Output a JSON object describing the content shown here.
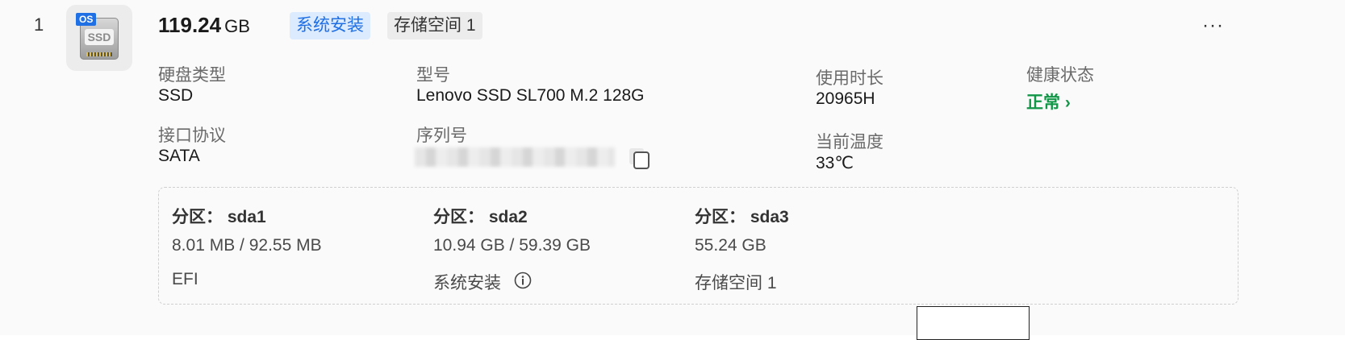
{
  "disk": {
    "index": "1",
    "icon_label": "SSD",
    "os_badge": "OS",
    "capacity_value": "119.24",
    "capacity_unit": "GB",
    "tags": [
      "系统安装",
      "存储空间 1"
    ],
    "more_label": "···"
  },
  "fields": {
    "disk_type_label": "硬盘类型",
    "disk_type_value": "SSD",
    "interface_label": "接口协议",
    "interface_value": "SATA",
    "model_label": "型号",
    "model_value": "Lenovo SSD SL700 M.2 128G",
    "serial_label": "序列号",
    "usage_label": "使用时长",
    "usage_value": "20965H",
    "temp_label": "当前温度",
    "temp_value": "33℃",
    "health_label": "健康状态",
    "health_value": "正常 ›"
  },
  "partitions": [
    {
      "title": "分区： sda1",
      "size": "8.01 MB / 92.55 MB",
      "purpose": "EFI"
    },
    {
      "title": "分区： sda2",
      "size": "10.94 GB / 59.39 GB",
      "purpose": "系统安装"
    },
    {
      "title": "分区： sda3",
      "size": "55.24 GB",
      "purpose": "存储空间 1"
    }
  ],
  "colors": {
    "accent": "#1f6fe5",
    "health": "#129748"
  },
  "icons": [
    "ssd-disk-icon",
    "copy-icon",
    "info-icon",
    "more-icon"
  ]
}
